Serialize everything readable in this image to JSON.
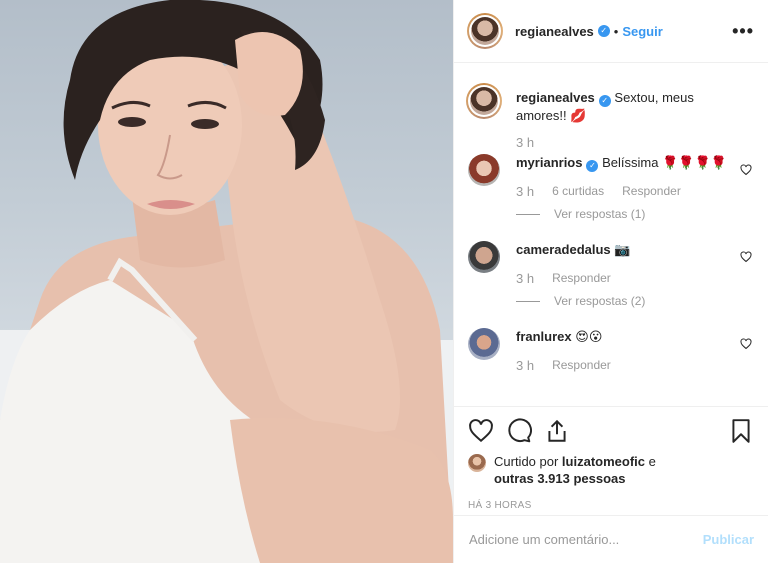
{
  "post": {
    "author": "regianealves",
    "follow_label": "Seguir",
    "more_label": "•••",
    "caption": "Sextou, meus amores!! 💋",
    "caption_time": "3 h"
  },
  "comments": [
    {
      "user": "myrianrios",
      "text": "Belíssima 🌹🌹🌹🌹",
      "time": "3 h",
      "likes": "6 curtidas",
      "reply_label": "Responder",
      "view_replies": "Ver respostas (1)"
    },
    {
      "user": "cameradedalus",
      "text": "📷",
      "time": "3 h",
      "reply_label": "Responder",
      "view_replies": "Ver respostas (2)"
    },
    {
      "user": "franlurex",
      "text": "😍😮",
      "time": "3 h",
      "reply_label": "Responder"
    }
  ],
  "likes": {
    "prefix": "Curtido por ",
    "user": "luizatomeofic",
    "mid": " e",
    "count": "outras 3.913 pessoas"
  },
  "posted_ago": "HÁ 3 HORAS",
  "comment_box": {
    "placeholder": "Adicione um comentário...",
    "publish_label": "Publicar"
  },
  "icons": [
    "heart-icon",
    "comment-icon",
    "share-icon",
    "bookmark-icon",
    "verified-icon"
  ],
  "colors": {
    "accent": "#3897f0",
    "muted": "#999999",
    "text": "#262626",
    "publish_disabled": "#b2dffc"
  }
}
